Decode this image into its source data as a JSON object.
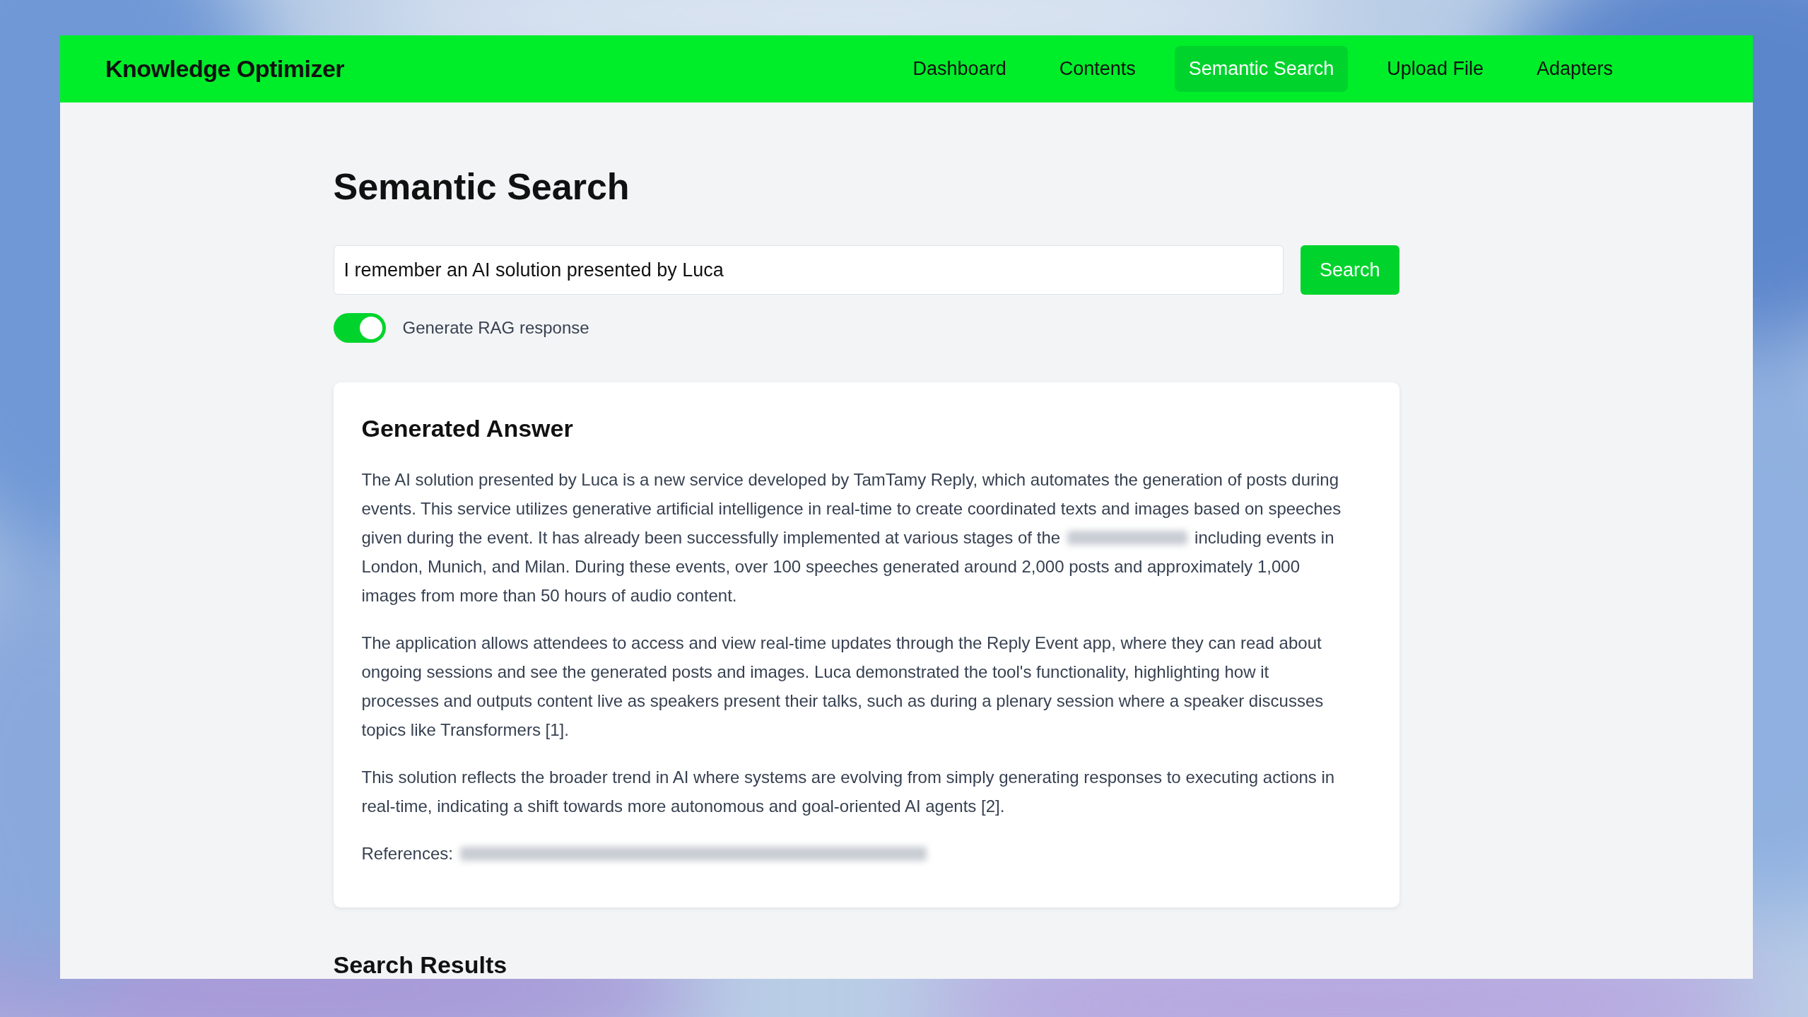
{
  "app": {
    "brand": "Knowledge Optimizer"
  },
  "nav": [
    {
      "label": "Dashboard",
      "selected": false
    },
    {
      "label": "Contents",
      "selected": false
    },
    {
      "label": "Semantic Search",
      "selected": true
    },
    {
      "label": "Upload File",
      "selected": false
    },
    {
      "label": "Adapters",
      "selected": false
    }
  ],
  "page": {
    "title": "Semantic Search"
  },
  "search": {
    "value": "I remember an AI solution presented by Luca",
    "button": "Search"
  },
  "rag_toggle": {
    "label": "Generate RAG response",
    "on": true
  },
  "answer": {
    "title": "Generated Answer",
    "paragraphs": [
      [
        [
          {
            "kind": "text",
            "text": "The AI solution presented by Luca is a new service developed by TamTamy Reply, which automates the generation of posts during"
          }
        ],
        [
          {
            "kind": "text",
            "text": "events. This service utilizes generative artificial intelligence in real-time to create coordinated texts and images based on speeches"
          }
        ],
        [
          {
            "kind": "text",
            "text": "given during the event. It has already been successfully implemented at various stages of the"
          },
          {
            "kind": "redacted"
          },
          {
            "kind": "text",
            "text": "including events in"
          }
        ],
        [
          {
            "kind": "text",
            "text": "London, Munich, and Milan. During these events, over 100 speeches generated around 2,000 posts and approximately 1,000"
          }
        ],
        [
          {
            "kind": "text",
            "text": "images from more than 50 hours of audio content."
          }
        ]
      ],
      [
        [
          {
            "kind": "text",
            "text": "The application allows attendees to access and view real-time updates through the Reply Event app, where they can read about"
          }
        ],
        [
          {
            "kind": "text",
            "text": "ongoing sessions and see the generated posts and images. Luca demonstrated the tool's functionality, highlighting how it"
          }
        ],
        [
          {
            "kind": "text",
            "text": "processes and outputs content live as speakers present their talks, such as during a plenary session where a speaker discusses"
          }
        ],
        [
          {
            "kind": "text",
            "text": "topics like Transformers [1]."
          }
        ]
      ],
      [
        [
          {
            "kind": "text",
            "text": "This solution reflects the broader trend in AI where systems are evolving from simply generating responses to executing actions in"
          }
        ],
        [
          {
            "kind": "text",
            "text": "real-time, indicating a shift towards more autonomous and goal-oriented AI agents [2]."
          }
        ]
      ],
      [
        [
          {
            "kind": "text",
            "text": "References:"
          },
          {
            "kind": "redacted"
          }
        ]
      ]
    ]
  },
  "results": {
    "title": "Search Results"
  }
}
